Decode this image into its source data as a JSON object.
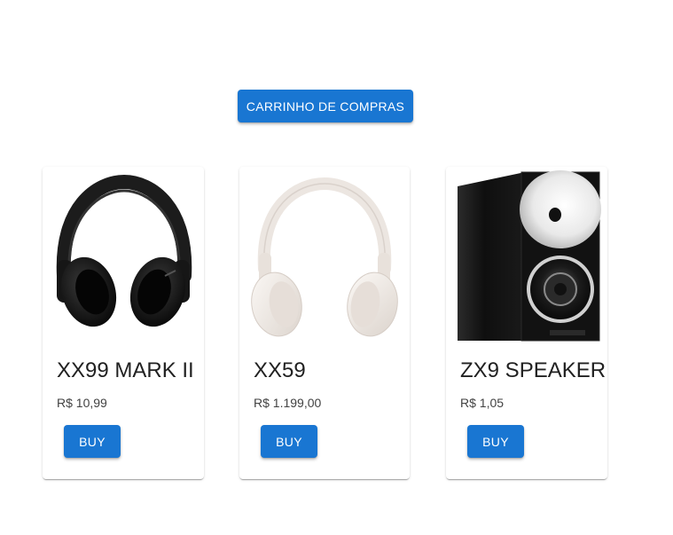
{
  "header": {
    "cart_button_label": "CARRINHO DE COMPRAS"
  },
  "products": [
    {
      "name": "XX99 MARK II",
      "price": "R$ 10,99",
      "buy_label": "BUY",
      "image": "black-headphones",
      "color": "#1a1a1a"
    },
    {
      "name": "XX59",
      "price": "R$ 1.199,00",
      "buy_label": "BUY",
      "image": "white-headphones",
      "color": "#efe9e4"
    },
    {
      "name": "ZX9 SPEAKER",
      "price": "R$ 1,05",
      "buy_label": "BUY",
      "image": "bookshelf-speaker",
      "color": "#111111"
    }
  ],
  "accent_color": "#1976d2"
}
